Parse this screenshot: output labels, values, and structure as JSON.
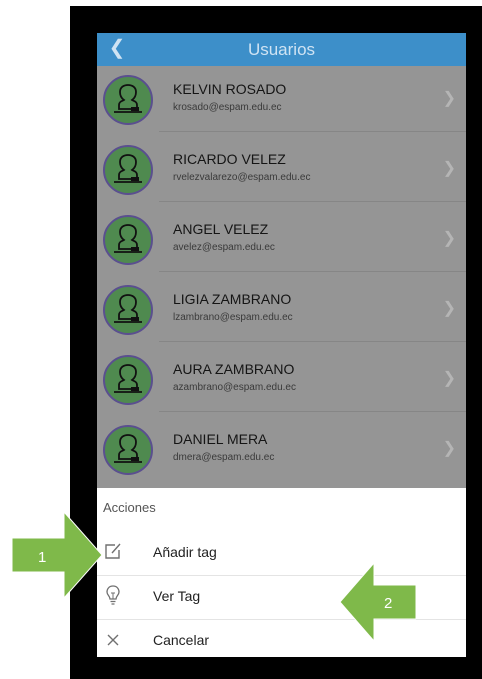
{
  "header": {
    "title": "Usuarios",
    "back_icon": "chevron-left-icon"
  },
  "users": [
    {
      "name": "KELVIN ROSADO",
      "email": "krosado@espam.edu.ec"
    },
    {
      "name": "RICARDO VELEZ",
      "email": "rvelezvalarezo@espam.edu.ec"
    },
    {
      "name": "ANGEL VELEZ",
      "email": "avelez@espam.edu.ec"
    },
    {
      "name": "LIGIA ZAMBRANO",
      "email": "lzambrano@espam.edu.ec"
    },
    {
      "name": "AURA ZAMBRANO",
      "email": "azambrano@espam.edu.ec"
    },
    {
      "name": "DANIEL MERA",
      "email": "dmera@espam.edu.ec"
    }
  ],
  "action_sheet": {
    "title": "Acciones",
    "actions": [
      {
        "label": "Añadir tag",
        "icon": "edit-icon"
      },
      {
        "label": "Ver Tag",
        "icon": "lightbulb-icon"
      },
      {
        "label": "Cancelar",
        "icon": "close-icon"
      }
    ]
  },
  "callouts": [
    {
      "number": "1"
    },
    {
      "number": "2"
    }
  ],
  "colors": {
    "header": "#3d8fc9",
    "callout": "#7fb94a",
    "avatar": "#4f8a4f",
    "overlay": "#959595"
  }
}
